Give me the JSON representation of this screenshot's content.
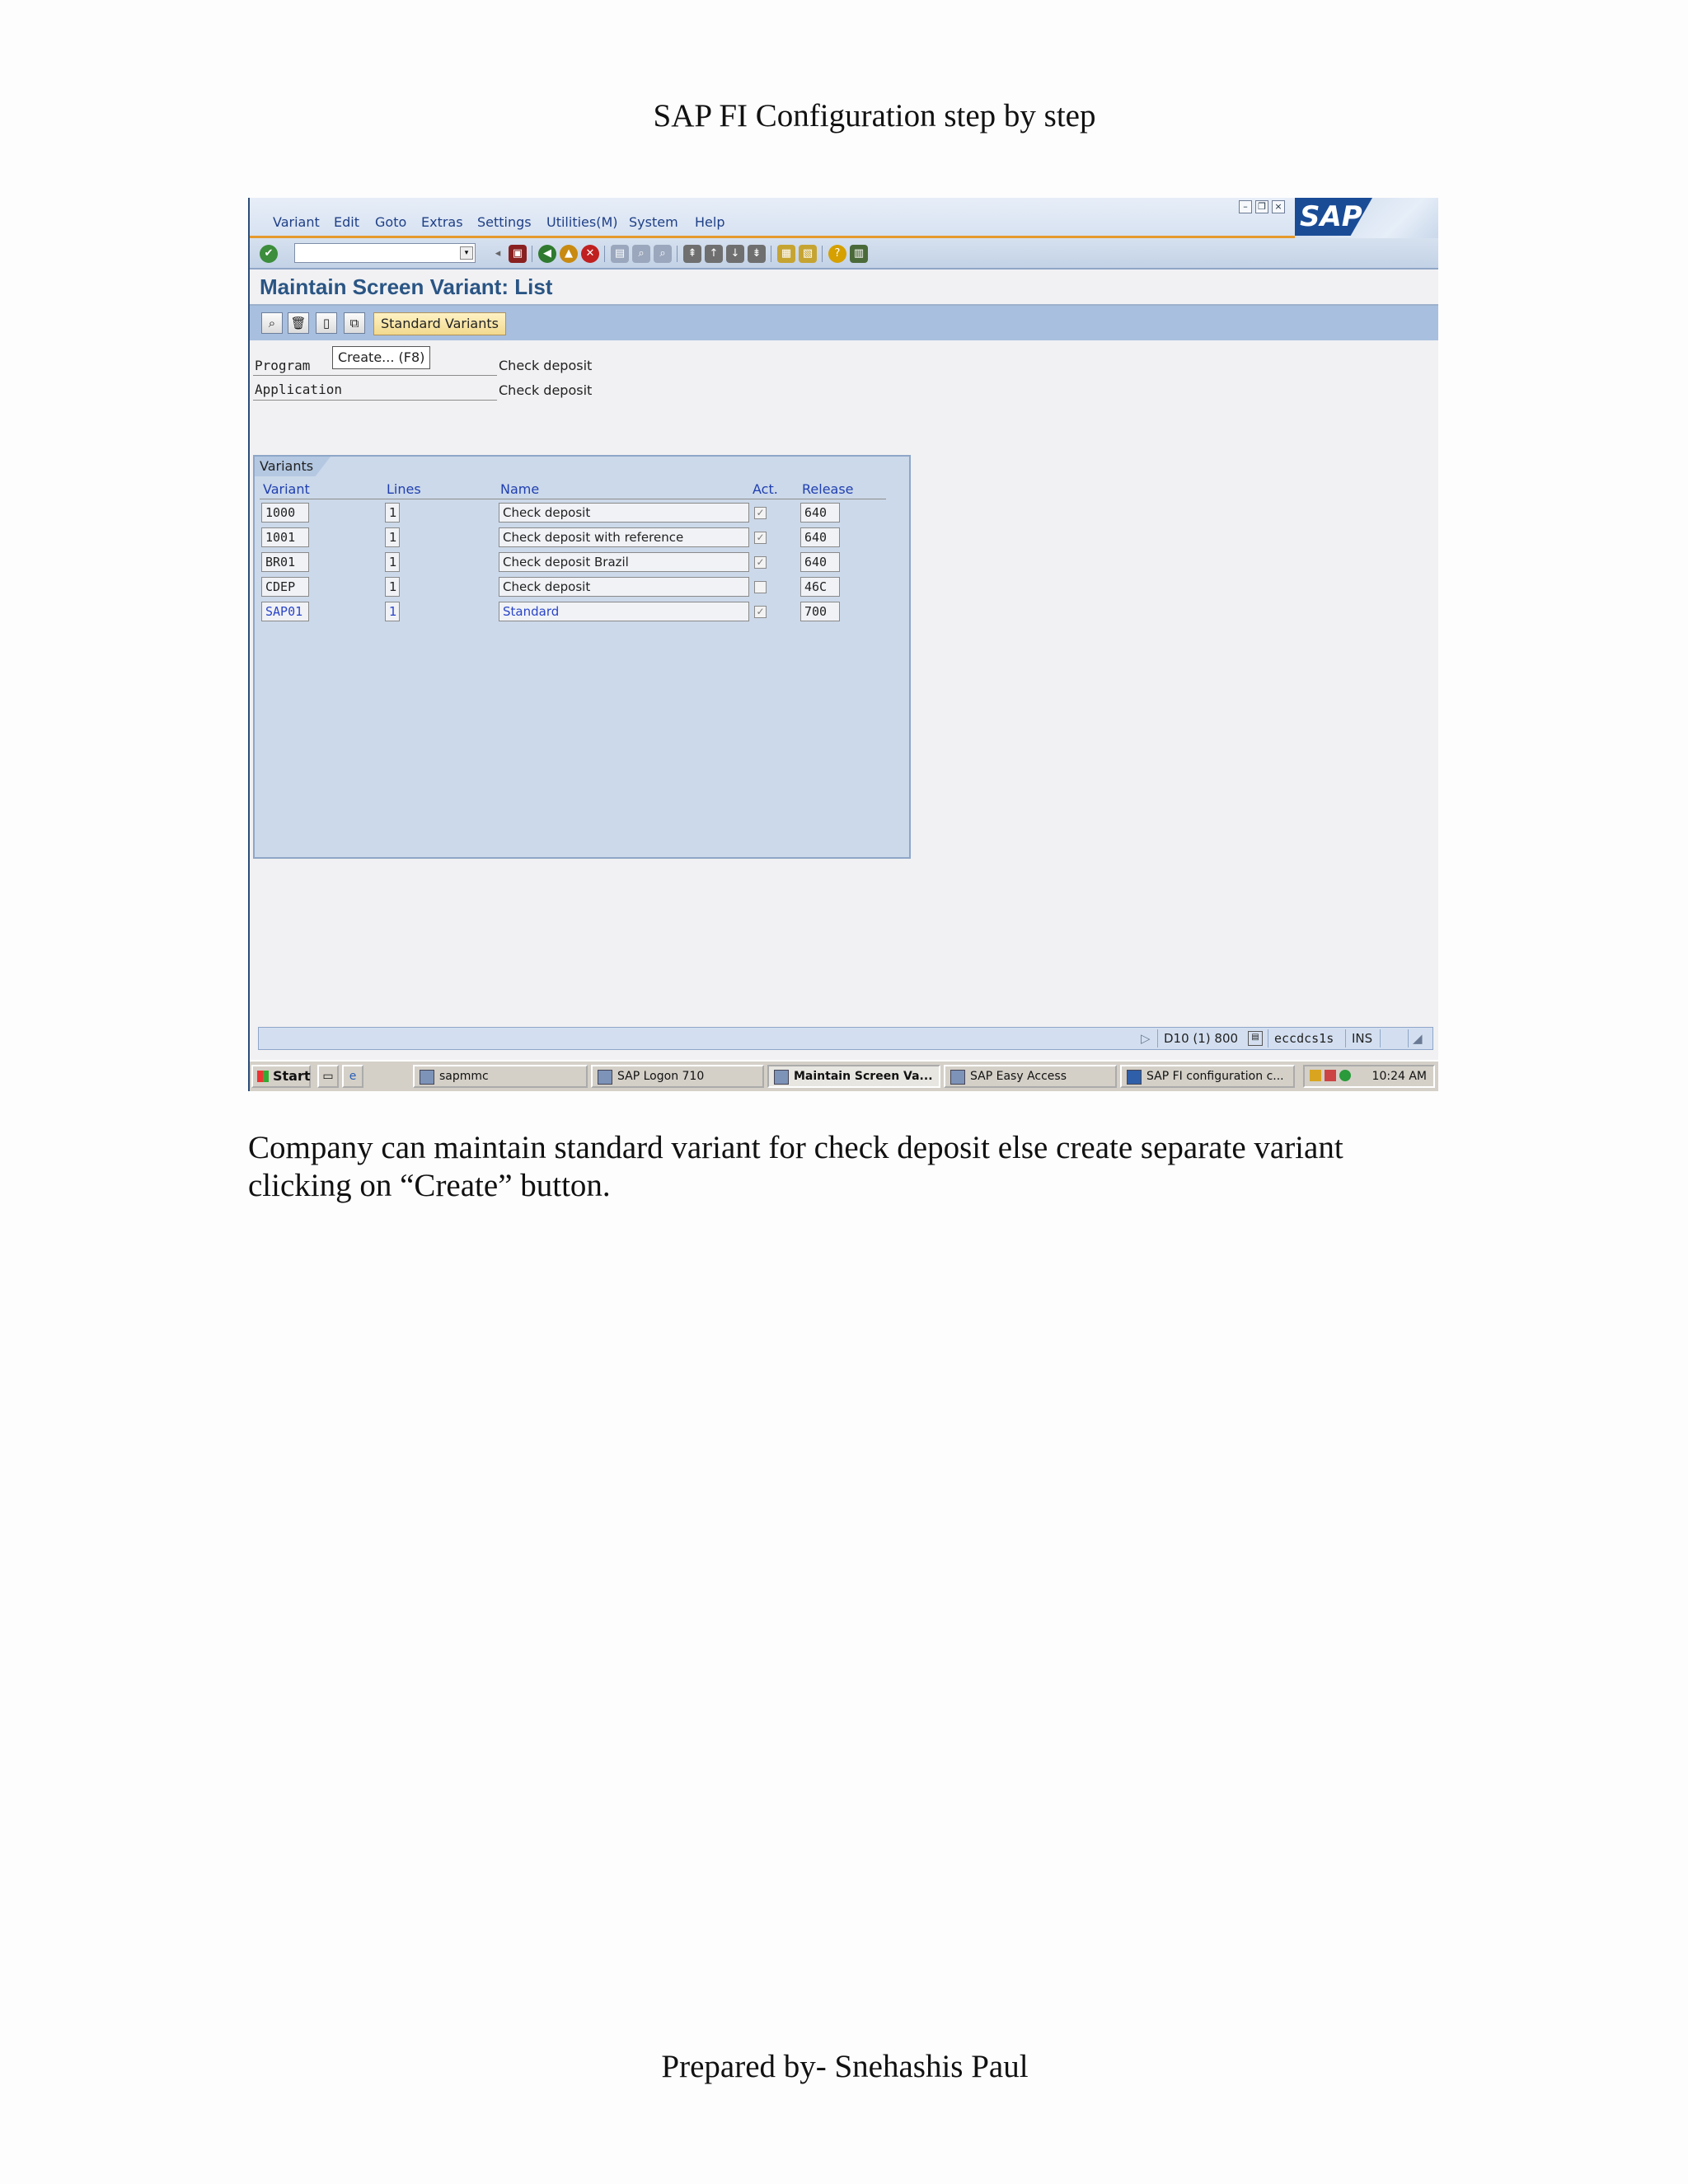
{
  "document": {
    "header": "SAP FI Configuration step by step",
    "caption": "Company can maintain standard variant for check deposit else create separate variant clicking on “Create” button.",
    "footer": "Prepared by- Snehashis Paul"
  },
  "sap": {
    "menu": [
      "Variant",
      "Edit",
      "Goto",
      "Extras",
      "Settings",
      "Utilities(M)",
      "System",
      "Help"
    ],
    "logo": "SAP",
    "screen_title": "Maintain Screen Variant: List",
    "standard_variants_button": "Standard Variants",
    "tooltip": "Create...  (F8)",
    "fields": {
      "program_label": "Program",
      "program_value": "Check deposit",
      "application_label": "Application",
      "application_value": "Check deposit"
    },
    "variants": {
      "tab": "Variants",
      "columns": [
        "Variant",
        "Lines",
        "Name",
        "Act.",
        "Release"
      ],
      "rows": [
        {
          "variant": "1000",
          "lines": "1",
          "name": "Check deposit",
          "act": true,
          "release": "640"
        },
        {
          "variant": "1001",
          "lines": "1",
          "name": "Check deposit with reference",
          "act": true,
          "release": "640"
        },
        {
          "variant": "BR01",
          "lines": "1",
          "name": "Check deposit Brazil",
          "act": true,
          "release": "640"
        },
        {
          "variant": "CDEP",
          "lines": "1",
          "name": "Check deposit",
          "act": false,
          "release": "46C"
        },
        {
          "variant": "SAP01",
          "lines": "1",
          "name": "Standard",
          "act": true,
          "release": "700"
        }
      ]
    },
    "status": {
      "system": "D10 (1) 800",
      "server": "eccdcs1s",
      "mode": "INS"
    },
    "taskbar": {
      "start": "Start",
      "tasks": [
        "sapmmc",
        "SAP Logon 710",
        "Maintain Screen Va...",
        "SAP Easy Access",
        "SAP FI configuration c..."
      ],
      "clock": "10:24 AM"
    }
  }
}
